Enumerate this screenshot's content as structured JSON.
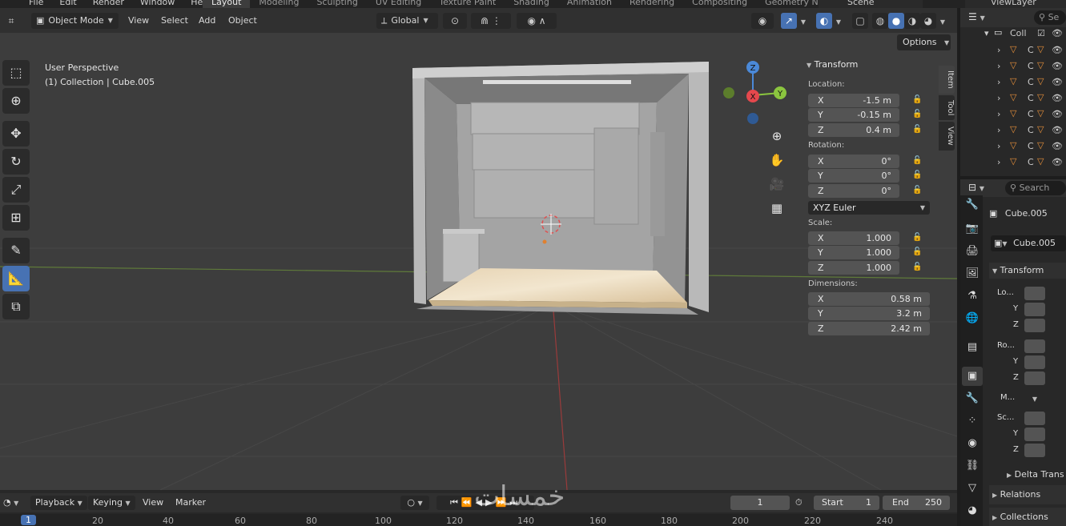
{
  "top_menu": {
    "items": [
      "File",
      "Edit",
      "Render",
      "Window",
      "Help"
    ]
  },
  "workspaces": [
    {
      "label": "Layout",
      "active": true
    },
    {
      "label": "Modeling"
    },
    {
      "label": "Sculpting"
    },
    {
      "label": "UV Editing"
    },
    {
      "label": "Texture Paint"
    },
    {
      "label": "Shading"
    },
    {
      "label": "Animation"
    },
    {
      "label": "Rendering"
    },
    {
      "label": "Compositing"
    },
    {
      "label": "Geometry Node"
    }
  ],
  "scene_name": "Scene",
  "view_layer": "ViewLayer",
  "viewport_header": {
    "mode": "Object Mode",
    "menus": [
      "View",
      "Select",
      "Add",
      "Object"
    ],
    "orientation": "Global",
    "options_label": "Options"
  },
  "viewport_info": {
    "perspective": "User Perspective",
    "collection_object": "(1) Collection | Cube.005"
  },
  "gizmo": {
    "x": "X",
    "y": "Y",
    "z": "Z"
  },
  "n_panel": {
    "header": "Transform",
    "location_label": "Location:",
    "location": [
      {
        "axis": "X",
        "value": "-1.5 m"
      },
      {
        "axis": "Y",
        "value": "-0.15 m"
      },
      {
        "axis": "Z",
        "value": "0.4 m"
      }
    ],
    "rotation_label": "Rotation:",
    "rotation": [
      {
        "axis": "X",
        "value": "0°"
      },
      {
        "axis": "Y",
        "value": "0°"
      },
      {
        "axis": "Z",
        "value": "0°"
      }
    ],
    "rotation_mode": "XYZ Euler",
    "scale_label": "Scale:",
    "scale": [
      {
        "axis": "X",
        "value": "1.000"
      },
      {
        "axis": "Y",
        "value": "1.000"
      },
      {
        "axis": "Z",
        "value": "1.000"
      }
    ],
    "dimensions_label": "Dimensions:",
    "dimensions": [
      {
        "axis": "X",
        "value": "0.58 m"
      },
      {
        "axis": "Y",
        "value": "3.2 m"
      },
      {
        "axis": "Z",
        "value": "2.42 m"
      }
    ],
    "tabs": [
      "Item",
      "Tool",
      "View"
    ]
  },
  "outliner": {
    "search_placeholder": "Se",
    "collection_label": "Coll",
    "rows": [
      "C",
      "C",
      "C",
      "C",
      "C",
      "C",
      "C",
      "C"
    ]
  },
  "properties": {
    "search_placeholder": "Search",
    "object_name": "Cube.005",
    "data_name": "Cube.005",
    "transform_header": "Transform",
    "labels": {
      "loc": "Lo...",
      "rot": "Ro...",
      "mode": "M...",
      "scale": "Sc...",
      "y": "Y",
      "z": "Z"
    },
    "delta_transform": "Delta Trans",
    "relations": "Relations",
    "collections": "Collections"
  },
  "timeline": {
    "menus": [
      "Playback",
      "Keying",
      "View",
      "Marker"
    ],
    "current_frame": "1",
    "start_label": "Start",
    "start_value": "1",
    "end_label": "End",
    "end_value": "250",
    "ruler": [
      "1",
      "20",
      "40",
      "60",
      "80",
      "100",
      "120",
      "140",
      "160",
      "180",
      "200",
      "220",
      "240"
    ]
  },
  "watermark": "خمسات",
  "colors": {
    "accent": "#4772b3",
    "x_axis": "#e5484d",
    "y_axis": "#8bc53f",
    "z_axis": "#4b89d8"
  }
}
